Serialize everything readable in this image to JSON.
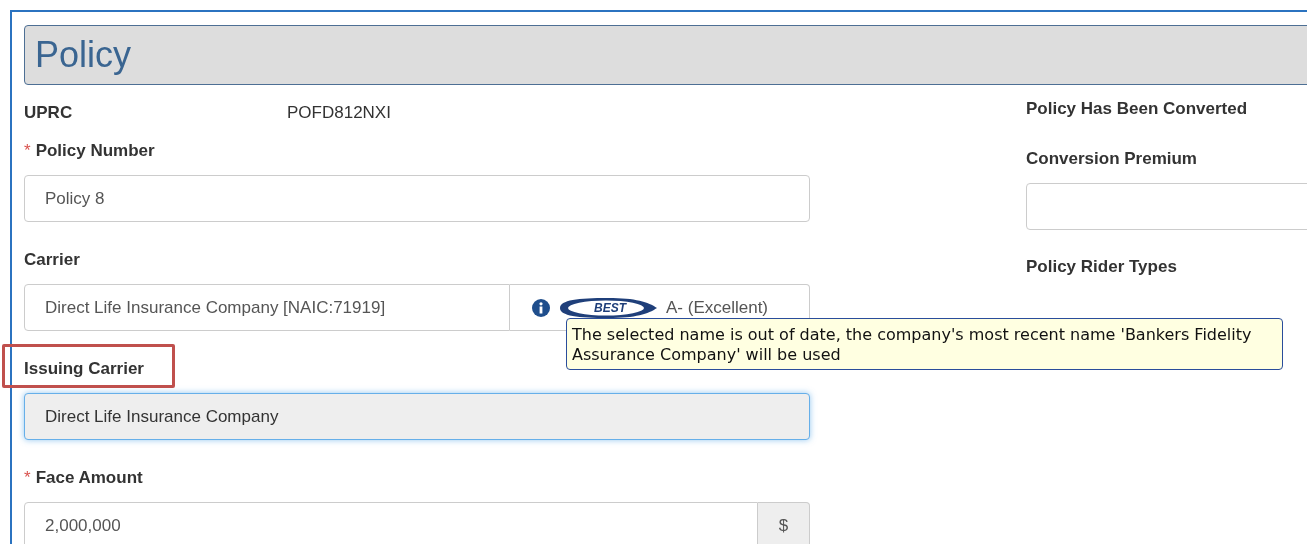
{
  "panel": {
    "title": "Policy"
  },
  "left_fields": [
    {
      "kind": "static",
      "label": "UPRC",
      "value": "POFD812NXI"
    },
    {
      "kind": "input",
      "label": "Policy Number",
      "required_mark": "*",
      "value": "Policy 8"
    },
    {
      "kind": "carrier",
      "label": "Carrier",
      "value": "Direct Life Insurance Company [NAIC:71919]",
      "rating_logo": "BEST",
      "rating": "A- (Excellent)",
      "tooltip": "The selected name is out of date, the company's most recent name 'Bankers Fidelity Assurance Company' will be used"
    },
    {
      "kind": "input",
      "label": "Issuing Carrier",
      "highlighted": true,
      "readonly": true,
      "focused": true,
      "value": "Direct Life Insurance Company"
    },
    {
      "kind": "addon",
      "label": "Face Amount",
      "required_mark": "*",
      "value": "2,000,000",
      "addon": "$"
    }
  ],
  "right_fields": [
    {
      "kind": "label",
      "label": "Policy Has Been Converted"
    },
    {
      "kind": "input",
      "label": "Conversion Premium"
    },
    {
      "kind": "label",
      "label": "Policy Rider Types"
    }
  ]
}
